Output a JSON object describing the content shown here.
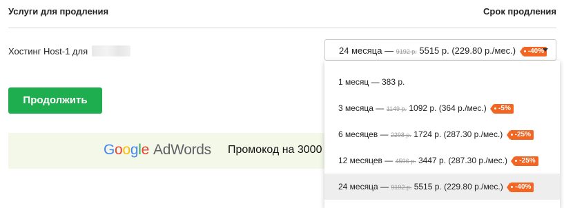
{
  "header": {
    "services_title": "Услуги для продления",
    "period_title": "Срок продления"
  },
  "service": {
    "label": "Хостинг Host-1 для"
  },
  "select": {
    "selected": {
      "period": "24 месяца —",
      "old_price": "9192 р.",
      "price": "5515 р. (229.80 р./мес.)",
      "discount": "-40%"
    },
    "options": [
      {
        "period": "1 месяц — 383 р.",
        "old_price": "",
        "price": "",
        "discount": ""
      },
      {
        "period": "3 месяца —",
        "old_price": "1149 р.",
        "price": "1092 р. (364 р./мес.)",
        "discount": "-5%"
      },
      {
        "period": "6 месяцев —",
        "old_price": "2298 р.",
        "price": "1724 р. (287.30 р./мес.)",
        "discount": "-25%"
      },
      {
        "period": "12 месяцев —",
        "old_price": "4596 р.",
        "price": "3447 р. (287.30 р./мес.)",
        "discount": "-25%"
      },
      {
        "period": "24 месяца —",
        "old_price": "9192 р.",
        "price": "5515 р. (229.80 р./мес.)",
        "discount": "-40%"
      }
    ]
  },
  "continue_button": "Продолжить",
  "banner": {
    "logo_google": "Google",
    "logo_adwords": "AdWords",
    "promo_text": "Промокод на 3000"
  },
  "colors": {
    "accent_green": "#1fae4f",
    "discount_orange": "#f26522",
    "banner_bg": "#f4f8e8"
  },
  "icons": {
    "dropdown": "caret-down-icon",
    "discount": "tag-icon"
  }
}
